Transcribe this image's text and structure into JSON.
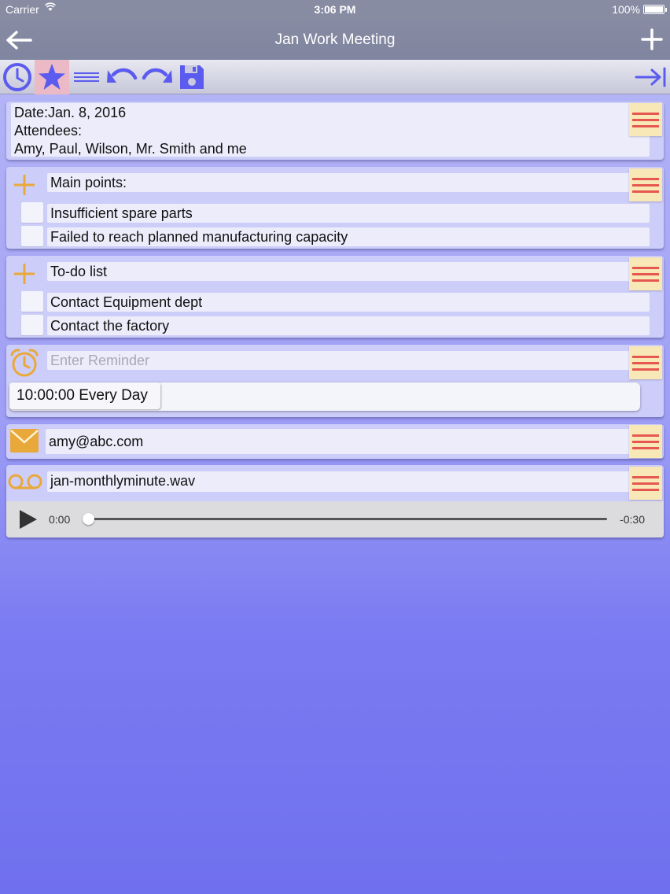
{
  "status_bar": {
    "carrier": "Carrier",
    "time": "3:06 PM",
    "battery": "100%"
  },
  "nav": {
    "title": "Jan Work Meeting",
    "back_icon": "arrow-left-icon",
    "add_icon": "plus-icon"
  },
  "toolbar": {
    "icons": [
      "clock-icon",
      "star-icon",
      "lines-icon",
      "undo-icon",
      "redo-icon",
      "save-icon",
      "tab-right-icon"
    ],
    "accent": "#5b5bf0"
  },
  "note": {
    "lines": [
      "Date:Jan. 8, 2016",
      "Attendees:",
      "Amy, Paul, Wilson, Mr. Smith and me"
    ]
  },
  "main_points": {
    "title": "Main points:",
    "items": [
      "Insufficient spare parts",
      "Failed to reach planned manufacturing capacity"
    ]
  },
  "todo": {
    "title": "To-do list",
    "items": [
      "Contact Equipment dept",
      "Contact the factory"
    ]
  },
  "reminder": {
    "placeholder": "Enter Reminder",
    "entry": "10:00:00 Every Day"
  },
  "email": {
    "value": "amy@abc.com"
  },
  "audio": {
    "filename": "jan-monthlyminute.wav",
    "elapsed": "0:00",
    "remaining": "-0:30",
    "progress": 0
  },
  "colors": {
    "icon_orange": "#e9a93a",
    "menu_red": "#e6584f",
    "menu_bg": "#f8e8b8"
  }
}
